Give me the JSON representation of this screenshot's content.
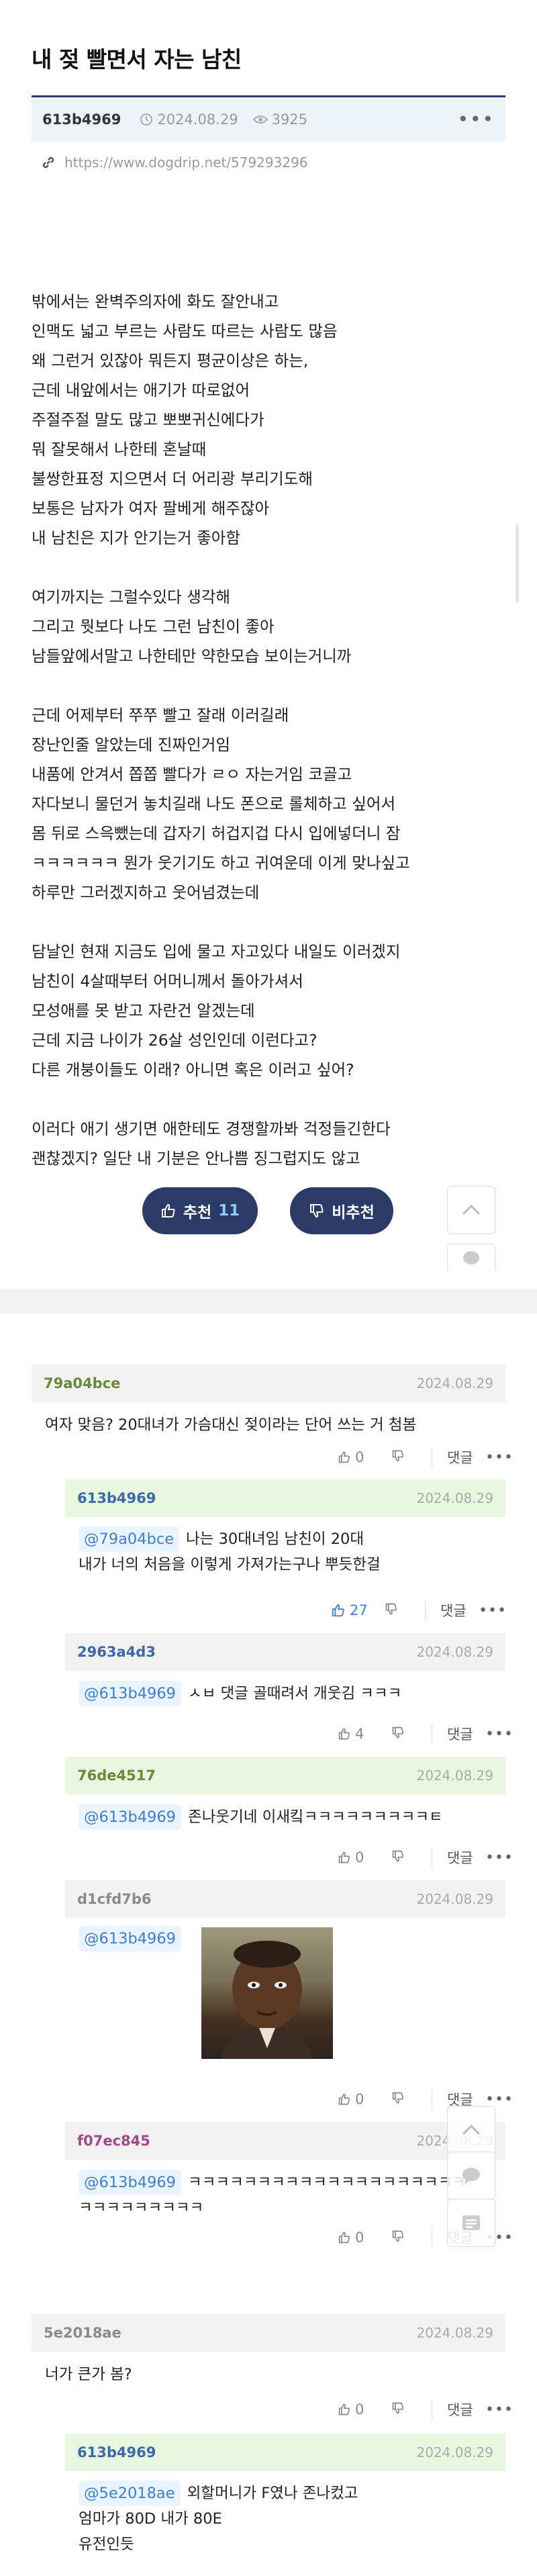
{
  "post": {
    "title": "내 젖 빨면서 자는 남친",
    "author": "613b4969",
    "date": "2024.08.29",
    "views": "3925",
    "link": "https://www.dogdrip.net/579293296",
    "body_lines": [
      "밖에서는 완벽주의자에 화도 잘안내고",
      "인맥도 넓고 부르는 사람도 따르는 사람도 많음",
      "왜 그런거 있잖아 뭐든지 평균이상은 하는,",
      "근데 내앞에서는 애기가 따로없어",
      "주절주절 말도 많고 뽀뽀귀신에다가",
      "뭐 잘못해서 나한테 혼날때",
      "불쌍한표정 지으면서 더 어리광 부리기도해",
      "보통은 남자가 여자 팔베게 해주잖아",
      "내 남친은 지가 안기는거 좋아함",
      "",
      "여기까지는 그럴수있다 생각해",
      "그리고 뭣보다 나도 그런 남친이 좋아",
      "남들앞에서말고 나한테만 약한모습 보이는거니까",
      "",
      "근데 어제부터 쭈쭈 빨고 잘래 이러길래",
      "장난인줄 알았는데 진짜인거임",
      "내품에 안겨서 쫍쫍 빨다가 ㄹㅇ 자는거임 코골고",
      "자다보니 물던거 놓치길래 나도 폰으로 롤체하고 싶어서",
      "몸 뒤로 스윽뺐는데 갑자기 허겁지겁 다시 입에넣더니 잠",
      "ㅋㅋㅋㅋㅋㅋ 뭔가 웃기기도 하고 귀여운데 이게 맞나싶고",
      "하루만 그러겠지하고 웃어넘겼는데",
      "",
      "담날인 현재 지금도 입에 물고 자고있다 내일도 이러겠지",
      "남친이 4살때부터 어머니께서 돌아가셔서",
      "모성애를 못 받고 자란건 알겠는데",
      "근데 지금 나이가 26살 성인인데 이런다고?",
      "다른 개붕이들도 이래? 아니면 혹은 이러고 싶어?",
      "",
      "이러다 애기 생기면 애한테도 경쟁할까봐 걱정들긴한다",
      "괜찮겠지? 일단 내 기분은 안나쁨 징그럽지도 않고"
    ],
    "upvote_label": "추천",
    "upvote_count": "11",
    "downvote_label": "비추천"
  },
  "comments": [
    {
      "author": "79a04bce",
      "date": "2024.08.29",
      "mention": "",
      "lines": [
        "여자 맞음? 20대녀가 가슴대신 젖이라는 단어 쓰는 거 첨봄"
      ],
      "up": "0",
      "reply_label": "댓글"
    },
    {
      "author": "613b4969",
      "date": "2024.08.29",
      "mention": "@79a04bce",
      "lines": [
        "나는 30대녀임 남친이 20대",
        "내가 너의 처음을 이렇게 가져가는구나 뿌듯한걸"
      ],
      "up": "27",
      "reply_label": "댓글"
    },
    {
      "author": "2963a4d3",
      "date": "2024.08.29",
      "mention": "@613b4969",
      "lines": [
        "ㅅㅂ 댓글 골때려서 개웃김 ㅋㅋㅋ"
      ],
      "up": "4",
      "reply_label": "댓글"
    },
    {
      "author": "76de4517",
      "date": "2024.08.29",
      "mention": "@613b4969",
      "lines": [
        "존나웃기네 이새킼ㅋㅋㅋㅋㅋㅋㅋㅋㅋㅌ"
      ],
      "up": "0",
      "reply_label": "댓글"
    },
    {
      "author": "d1cfd7b6",
      "date": "2024.08.29",
      "mention": "@613b4969",
      "lines": [],
      "up": "0",
      "reply_label": "댓글"
    },
    {
      "author": "f07ec845",
      "date": "2024.08.29",
      "mention": "@613b4969",
      "lines": [
        "ㅋㅋㅋㅋㅋㅋㅋㅋㅋㅋㅋㅋㅋㅋㅋㅋㅋㅋㅋㅋ",
        "ㅋㅋㅋㅋㅋㅋㅋㅋㅋ"
      ],
      "up": "0",
      "reply_label": "댓글"
    },
    {
      "author": "5e2018ae",
      "date": "2024.08.29",
      "mention": "",
      "lines": [
        "너가 큰가 봄?"
      ],
      "up": "0",
      "reply_label": "댓글"
    },
    {
      "author": "613b4969",
      "date": "2024.08.29",
      "mention": "@5e2018ae",
      "lines": [
        "외할머니가 F였나 존나컸고",
        "엄마가 80D 내가 80E",
        "유전인듯"
      ],
      "up": "",
      "reply_label": ""
    }
  ],
  "colors": {
    "navy": "#2b3a67",
    "author_green": "#6a8a3a",
    "author_blue": "#3a6aa8",
    "author_gray": "#8a8a8a",
    "author_purple": "#a04a8a",
    "mention_blue": "#3d7fd6"
  }
}
